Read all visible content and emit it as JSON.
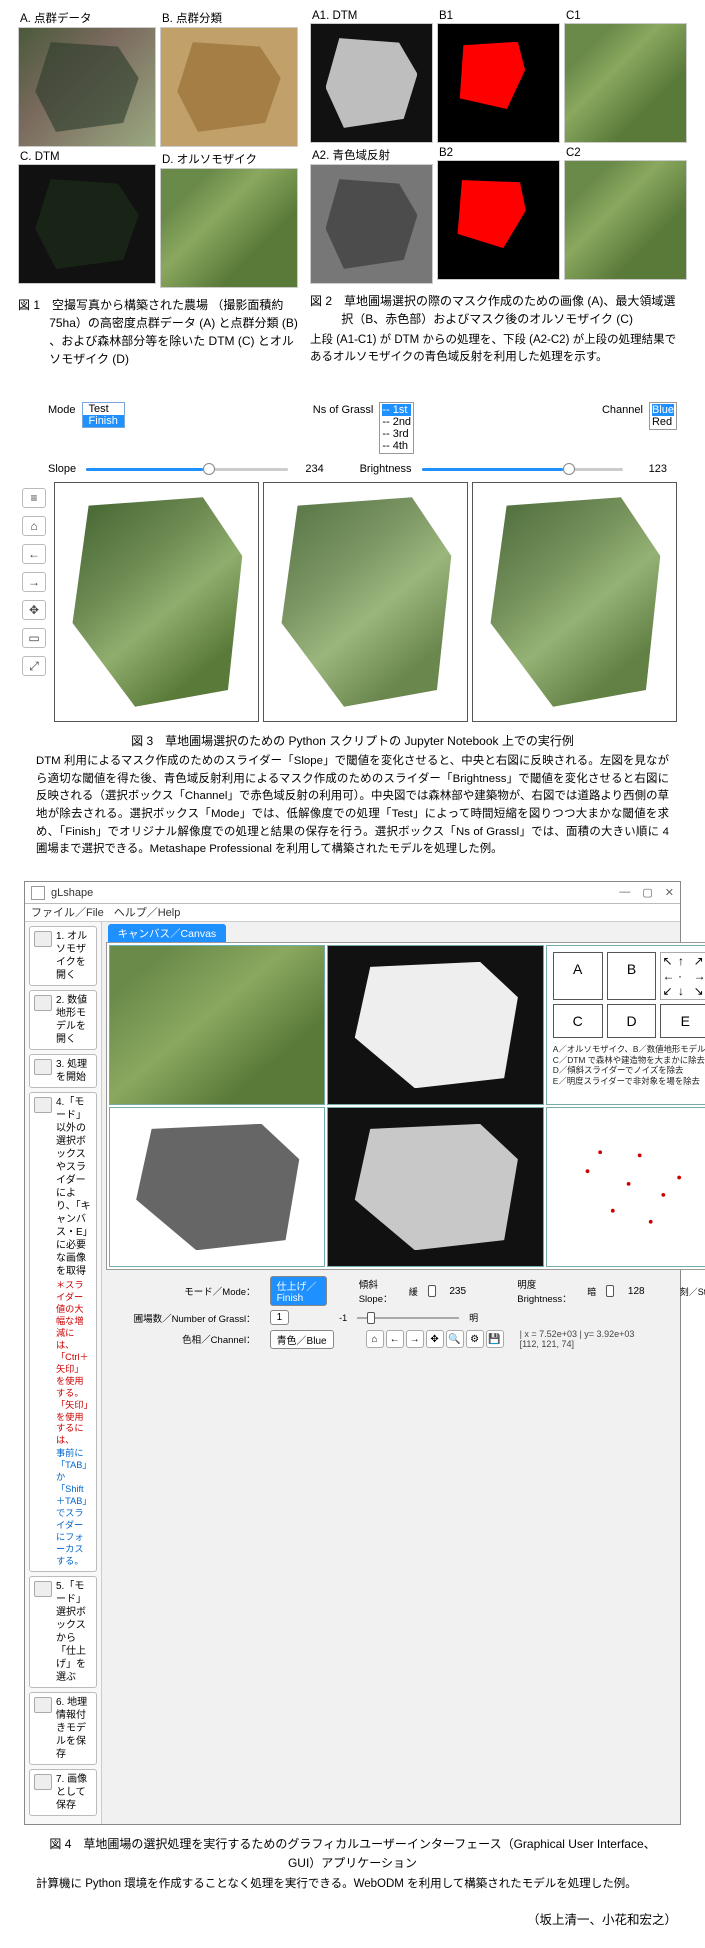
{
  "fig1": {
    "panels": {
      "A": "A. 点群データ",
      "B": "B. 点群分類",
      "C": "C. DTM",
      "D": "D. オルソモザイク"
    },
    "caption_line1": "図 1　空撮写真から構築された農場",
    "caption_rest": "（撮影面積約 75ha）の高密度点群データ (A) と点群分類 (B) 、および森林部分等を除いた DTM (C) とオルソモザイク (D)"
  },
  "fig2": {
    "panels": {
      "A1": "A1. DTM",
      "B1": "B1",
      "C1": "C1",
      "A2": "A2. 青色域反射",
      "B2": "B2",
      "C2": "C2"
    },
    "caption_line1": "図 2　草地圃場選択の際のマスク作成のための画像",
    "caption_rest": "(A)、最大領域選択（B、赤色部）およびマスク後のオルソモザイク (C)",
    "sub": "上段 (A1-C1) が DTM からの処理を、下段 (A2-C2) が上段の処理結果であるオルソモザイクの青色域反射を利用した処理を示す。"
  },
  "fig3": {
    "mode_label": "Mode",
    "mode_options": [
      "Test",
      "Finish"
    ],
    "mode_selected": "Finish",
    "ns_label": "Ns of Grassl",
    "ns_options": [
      "-- 1st",
      "-- 2nd",
      "-- 3rd",
      "-- 4th"
    ],
    "ns_selected": "-- 1st",
    "channel_label": "Channel",
    "channel_options": [
      "Blue",
      "Red"
    ],
    "channel_selected": "Blue",
    "slope_label": "Slope",
    "slope_value": "234",
    "brightness_label": "Brightness",
    "brightness_value": "123",
    "toolbar_icons": [
      "≡",
      "⌂",
      "←",
      "→",
      "✥",
      "▭",
      "⤢"
    ],
    "caption_title": "図 3　草地圃場選択のための Python スクリプトの Jupyter Notebook 上での実行例",
    "caption_body": "DTM 利用によるマスク作成のためのスライダー「Slope」で閾値を変化させると、中央と右図に反映される。左図を見ながら適切な閾値を得た後、青色域反射利用によるマスク作成のためのスライダー「Brightness」で閾値を変化させると右図に反映される（選択ボックス「Channel」で赤色域反射の利用可）。中央図では森林部や建築物が、右図では道路より西側の草地が除去される。選択ボックス「Mode」では、低解像度での処理「Test」によって時間短縮を図りつつ大まかな閾値を求め、「Finish」でオリジナル解像度での処理と結果の保存を行う。選択ボックス「Ns of Grassl」では、面積の大きい順に 4 圃場まで選択できる。Metashape Professional を利用して構築されたモデルを処理した例。"
  },
  "fig4": {
    "window_title": "gLshape",
    "menu_file": "ファイル／File",
    "menu_help": "ヘルプ／Help",
    "steps": [
      {
        "text": "1. オルソモザイクを開く"
      },
      {
        "text": "2. 数値地形モデルを開く"
      },
      {
        "text": "3. 処理を開始"
      },
      {
        "text": "4.「モード」以外の選択ボックスやスライダーにより、「キャンバス・E」に必要な画像を取得",
        "red": "＊スライダー値の大幅な増減には、「Ctrl＋矢印」を使用する。「矢印」を使用するには、",
        "blue": "事前に「TAB」か「Shift＋TAB」でスライダーにフォーカスする。"
      },
      {
        "text": "5.「モード」選択ボックスから「仕上げ」を選ぶ"
      },
      {
        "text": "6. 地理情報付きモデルを保存"
      },
      {
        "text": "7. 画像として保存"
      }
    ],
    "canvas_tab": "キャンバス／Canvas",
    "buttons": [
      "A",
      "B",
      "C",
      "D",
      "E"
    ],
    "button_legend": "A／オルソモザイク、B／数値地形モデル\nC／DTM で森林や建造物を大まかに除去\nD／傾斜スライダーでノイズを除去\nE／明度スライダーで非対象を場を除去",
    "ctrl_mode_label": "モード／Mode：",
    "ctrl_mode_value": "仕上げ／Finish",
    "ctrl_slope_label": "傾斜\nSlope：",
    "ctrl_slope_value": "235",
    "ctrl_brightness_label": "明度\nBrightness：",
    "ctrl_brightness_value": "128",
    "ctrl_step_label": "刻／Step",
    "ctrl_ns_label": "圃場数／Number of Grassl：",
    "ctrl_ns_value": "1",
    "ctrl_ns_range_lo": "-1",
    "ctrl_ns_range_hi": "明",
    "ctrl_channel_label": "色相／Channel：",
    "ctrl_channel_value": "青色／Blue",
    "readout_xy": "| x = 7.52e+03 | y= 3.92e+03",
    "readout_rgb": "[112, 121, 74]",
    "caption_title": "図 4　草地圃場の選択処理を実行するためのグラフィカルユーザーインターフェース（Graphical User Interface、GUI）アプリケーション",
    "caption_body": "計算機に Python 環境を作成することなく処理を実行できる。WebODM を利用して構築されたモデルを処理した例。"
  },
  "authors": "（坂上清一、小花和宏之）"
}
